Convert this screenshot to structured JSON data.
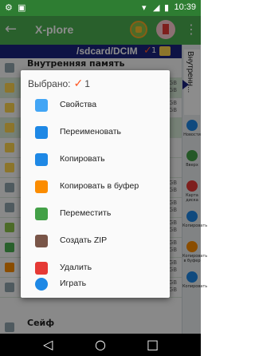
{
  "status_bar": {
    "time": "10:39",
    "icons": [
      "settings-icon",
      "image-icon",
      "wifi-icon",
      "signal-icon",
      "battery-icon"
    ]
  },
  "app_bar": {
    "title": "X-plore",
    "back_icon": "arrow-back-icon",
    "more_icon": "more-vert-icon"
  },
  "path_bar": {
    "path": "/sdcard/DCIM",
    "selected_count": "1"
  },
  "file_list": {
    "header_label": "Внутренняя память",
    "rows": [
      {
        "meta": "Свободно: 20GB\nВсего: 11GB"
      },
      {
        "meta": "Свободно: 20GB\nВсего: 11GB"
      },
      {
        "meta": ""
      },
      {
        "meta": ""
      },
      {
        "meta": ""
      },
      {
        "meta": "Свободно: 20GB\nВсего: 11GB"
      },
      {
        "meta": "Свободно: 20GB\nВсего: 11GB"
      },
      {
        "meta": "Свободно: 20GB\nВсего: 11GB"
      },
      {
        "meta": "Свободно: 20GB\nВсего: 11GB"
      },
      {
        "meta": "Свободно: 20GB\nВсего: 11GB"
      },
      {
        "meta": "Свободно: 20GB\nВсего: 11GB"
      }
    ],
    "footer_label": "Сейф"
  },
  "side_panel": {
    "vertical_label": "Внутренн...",
    "tools": [
      {
        "label": "Новости",
        "icon": "info-icon",
        "color": "#1e88e5"
      },
      {
        "label": "Вверх",
        "icon": "up-arrow-icon",
        "color": "#43a047"
      },
      {
        "label": "Карта диска",
        "icon": "disk-map-icon",
        "color": "#e53935"
      },
      {
        "label": "Копировать",
        "icon": "copy-icon",
        "color": "#1e88e5"
      },
      {
        "label": "Копировать в буфер",
        "icon": "clipboard-icon",
        "color": "#fb8c00"
      },
      {
        "label": "Копировать",
        "icon": "copy-icon",
        "color": "#1e88e5"
      }
    ]
  },
  "menu": {
    "header_label": "Выбрано:",
    "header_count": "1",
    "items": [
      {
        "label": "Свойства",
        "icon": "properties-icon",
        "color": "#42a5f5"
      },
      {
        "label": "Переименовать",
        "icon": "rename-icon",
        "color": "#1e88e5"
      },
      {
        "label": "Копировать",
        "icon": "copy-icon",
        "color": "#1e88e5"
      },
      {
        "label": "Копировать в буфер",
        "icon": "clipboard-icon",
        "color": "#fb8c00"
      },
      {
        "label": "Переместить",
        "icon": "move-icon",
        "color": "#43a047"
      },
      {
        "label": "Создать ZIP",
        "icon": "zip-icon",
        "color": "#795548"
      },
      {
        "label": "Удалить",
        "icon": "delete-icon",
        "color": "#e53935"
      },
      {
        "label": "Играть",
        "icon": "play-icon",
        "color": "#1e88e5"
      }
    ]
  },
  "nav_bar": {
    "back": "◁",
    "home": "○",
    "recents": "□"
  }
}
